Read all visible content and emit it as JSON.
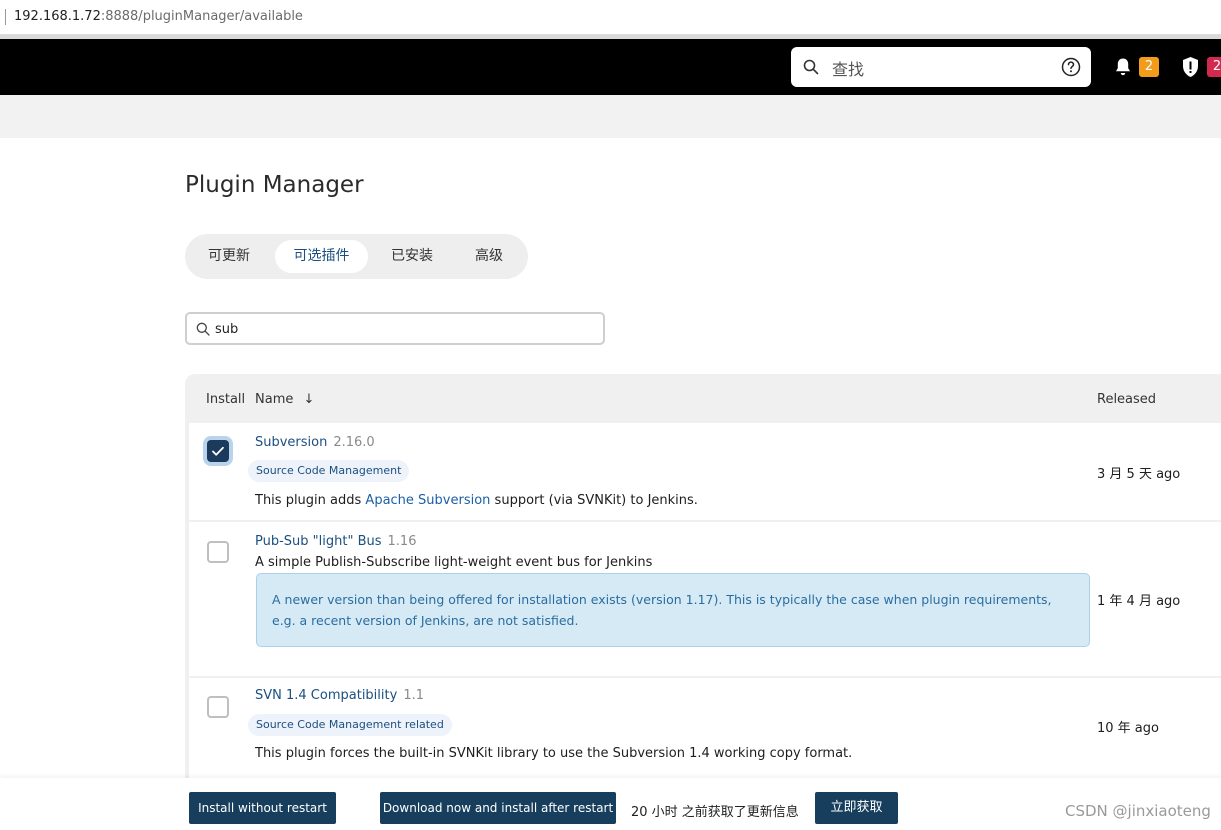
{
  "browser": {
    "url_host": "192.168.1.72",
    "url_rest": ":8888/pluginManager/available"
  },
  "header": {
    "search_placeholder": "查找",
    "notifications_count": "2",
    "security_count": "2"
  },
  "page": {
    "title": "Plugin Manager"
  },
  "tabs": [
    {
      "label": "可更新",
      "active": false
    },
    {
      "label": "可选插件",
      "active": true
    },
    {
      "label": "已安装",
      "active": false
    },
    {
      "label": "高级",
      "active": false
    }
  ],
  "filter": {
    "value": "sub"
  },
  "table": {
    "headers": {
      "install": "Install",
      "name": "Name",
      "sort_indicator": "↓",
      "released": "Released"
    },
    "rows": [
      {
        "name": "Subversion",
        "version": "2.16.0",
        "category": "Source Code Management",
        "desc_before": "This plugin adds ",
        "desc_link": "Apache Subversion",
        "desc_after": " support (via SVNKit) to Jenkins.",
        "released": "3 月 5 天 ago",
        "checked": true
      },
      {
        "name": "Pub-Sub \"light\" Bus",
        "version": "1.16",
        "description": "A simple Publish-Subscribe light-weight event bus for Jenkins",
        "notice": "A newer version than being offered for installation exists (version 1.17). This is typically the case when plugin requirements, e.g. a recent version of Jenkins, are not satisfied.",
        "released": "1 年 4 月 ago",
        "checked": false
      },
      {
        "name": "SVN 1.4 Compatibility",
        "version": "1.1",
        "category": "Source Code Management related",
        "description": "This plugin forces the built-in SVNKit library to use the Subversion 1.4 working copy format.",
        "released": "10 年 ago",
        "checked": false
      }
    ]
  },
  "footer": {
    "install_without_restart": "Install without restart",
    "download_install_after_restart": "Download now and install after restart",
    "update_info": "20 小时 之前获取了更新信息",
    "fetch_now": "立即获取",
    "watermark": "CSDN @jinxiaoteng"
  },
  "colors": {
    "topbar": "#000000",
    "primary_button": "#173e5c",
    "link": "#1b4f80",
    "notice_bg": "#d6eaf6",
    "badge_orange": "#f39b1a",
    "badge_red": "#d2294f"
  }
}
